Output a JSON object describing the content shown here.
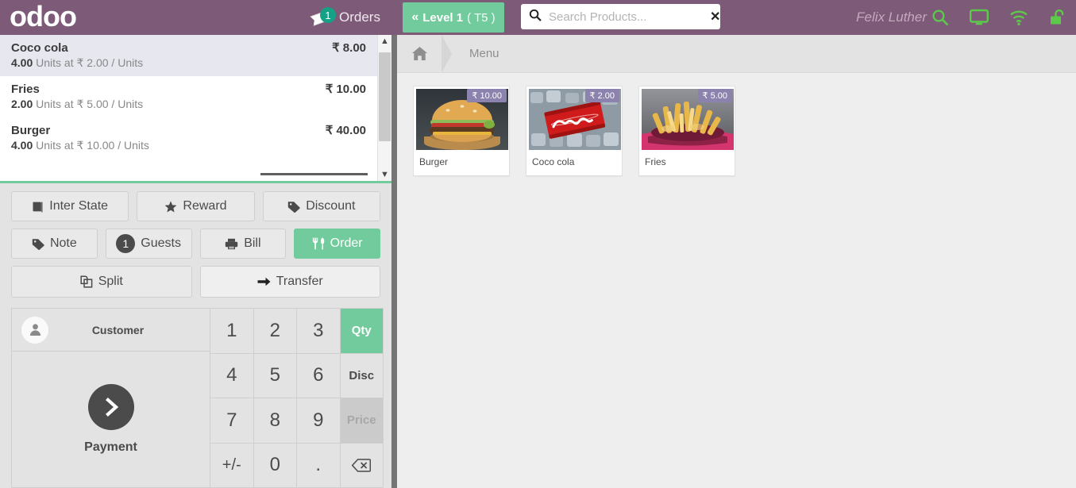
{
  "header": {
    "logo": "odoo",
    "orders": {
      "label": "Orders",
      "badge": "1",
      "icon": "receipt-icon"
    },
    "level_button": {
      "name": "Level 1",
      "table": "( T5 )",
      "icon": "chevron-double-left-icon"
    },
    "search": {
      "value": "",
      "placeholder": "Search Products...",
      "icon": "search-icon",
      "clear_icon": "close-icon"
    },
    "username": "Felix Luther",
    "icons": [
      "search-icon",
      "monitor-icon",
      "wifi-icon",
      "unlock-icon"
    ],
    "colors": {
      "bar": "#7d5a78",
      "accent_green": "#72cb9c",
      "badge_teal": "#16a085"
    }
  },
  "order": {
    "lines": [
      {
        "name": "Coco cola",
        "qty": "4.00",
        "detail": "Units at ₹ 2.00 / Units",
        "price": "₹ 8.00",
        "selected": true
      },
      {
        "name": "Fries",
        "qty": "2.00",
        "detail": "Units at ₹ 5.00 / Units",
        "price": "₹ 10.00",
        "selected": false
      },
      {
        "name": "Burger",
        "qty": "4.00",
        "detail": "Units at ₹ 10.00 / Units",
        "price": "₹ 40.00",
        "selected": false
      }
    ],
    "scrollbar": {
      "up_icon": "chevron-up-icon",
      "down_icon": "chevron-down-icon"
    }
  },
  "actions": {
    "row1": [
      {
        "label": "Inter State",
        "icon": "book-icon",
        "style": "default"
      },
      {
        "label": "Reward",
        "icon": "star-icon",
        "style": "default"
      },
      {
        "label": "Discount",
        "icon": "tag-icon",
        "style": "default"
      }
    ],
    "row2": [
      {
        "label": "Note",
        "icon": "tag-icon",
        "style": "default"
      },
      {
        "label": "Guests",
        "icon": "guest-count-badge",
        "badge": "1",
        "style": "default"
      },
      {
        "label": "Bill",
        "icon": "printer-icon",
        "style": "default"
      },
      {
        "label": "Order",
        "icon": "cutlery-icon",
        "style": "green"
      }
    ],
    "row3": [
      {
        "label": "Split",
        "icon": "copy-icon",
        "style": "default"
      },
      {
        "label": "Transfer",
        "icon": "arrow-right-icon",
        "style": "light"
      }
    ]
  },
  "customer": {
    "label": "Customer",
    "avatar_icon": "person-icon",
    "payment_label": "Payment",
    "payment_icon": "chevron-right-icon"
  },
  "numpad": {
    "keys": [
      {
        "label": "1",
        "kind": "digit"
      },
      {
        "label": "2",
        "kind": "digit"
      },
      {
        "label": "3",
        "kind": "digit"
      },
      {
        "label": "Qty",
        "kind": "mode",
        "state": "active"
      },
      {
        "label": "4",
        "kind": "digit"
      },
      {
        "label": "5",
        "kind": "digit"
      },
      {
        "label": "6",
        "kind": "digit"
      },
      {
        "label": "Disc",
        "kind": "mode",
        "state": "normal"
      },
      {
        "label": "7",
        "kind": "digit"
      },
      {
        "label": "8",
        "kind": "digit"
      },
      {
        "label": "9",
        "kind": "digit"
      },
      {
        "label": "Price",
        "kind": "mode",
        "state": "disabled"
      },
      {
        "label": "+/-",
        "kind": "small"
      },
      {
        "label": "0",
        "kind": "digit"
      },
      {
        "label": ".",
        "kind": "digit"
      },
      {
        "label": "backspace-icon",
        "kind": "icon"
      }
    ]
  },
  "breadcrumb": {
    "home_icon": "home-icon",
    "items": [
      "Menu"
    ]
  },
  "products": [
    {
      "name": "Burger",
      "price": "₹ 10.00",
      "image": "burger-photo"
    },
    {
      "name": "Coco cola",
      "price": "₹ 2.00",
      "image": "coca-cola-can-photo"
    },
    {
      "name": "Fries",
      "price": "₹ 5.00",
      "image": "fries-photo"
    }
  ]
}
